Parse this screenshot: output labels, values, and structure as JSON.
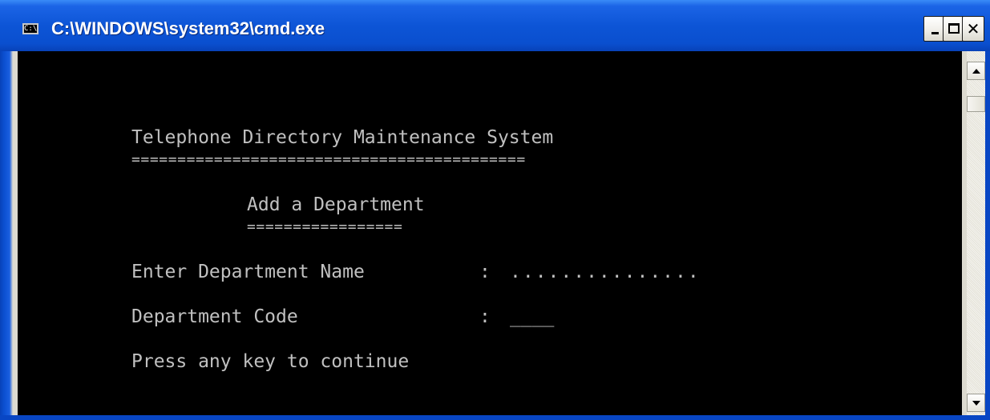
{
  "window": {
    "title": "C:\\WINDOWS\\system32\\cmd.exe",
    "icon_label": "C:\\",
    "close_glyph": "✕",
    "colors": {
      "titlebar": "#0a4fcf",
      "console_bg": "#000000",
      "console_text": "#c0c0c0"
    }
  },
  "console": {
    "title": "Telephone Directory Maintenance System",
    "title_underline": "===========================================",
    "subtitle": "Add a Department",
    "subtitle_underline": "=================",
    "name_label": "Enter Department Name",
    "name_colon": ":",
    "name_input": "...............",
    "code_label": "Department Code",
    "code_colon": ":",
    "code_input": "____",
    "prompt": "Press any key to continue"
  }
}
